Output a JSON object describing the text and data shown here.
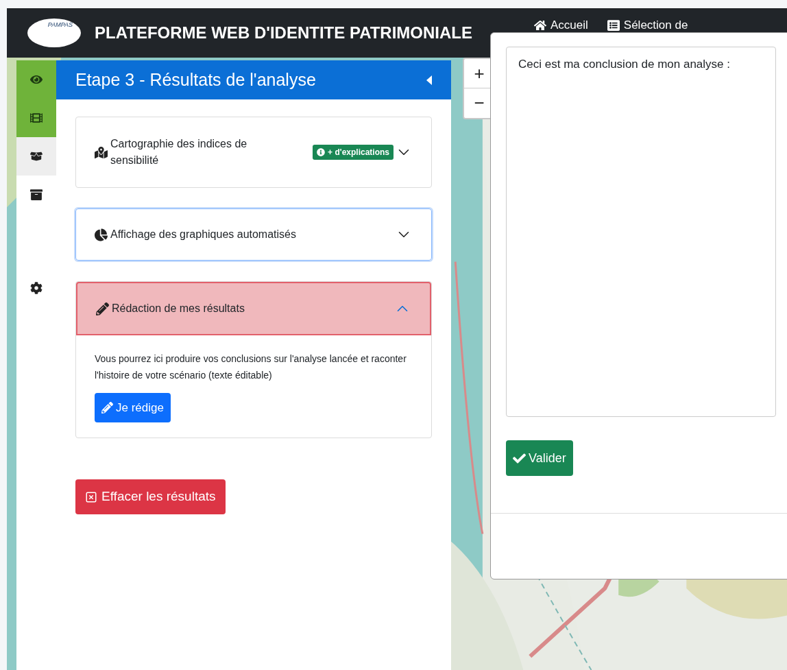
{
  "header": {
    "logo_text": "PAMPAS",
    "title": "PLATEFORME WEB D'IDENTITE PATRIMONIALE",
    "nav": [
      {
        "label": "Accueil",
        "kind": "home"
      },
      {
        "label": "Sélection de",
        "kind": "list"
      }
    ]
  },
  "sidebar": {
    "items": [
      {
        "kind": "eye",
        "highlighted": true,
        "selected": false
      },
      {
        "kind": "film",
        "highlighted": true,
        "selected": false
      },
      {
        "kind": "box",
        "highlighted": false,
        "selected": true
      },
      {
        "kind": "archive",
        "highlighted": false,
        "selected": false
      },
      {
        "kind": "gear",
        "highlighted": false,
        "selected": false
      }
    ]
  },
  "panel": {
    "title": "Etape 3 - Résultats de l'analyse",
    "sections": [
      {
        "kind": "map",
        "title": "Cartographie des indices de sensibilité",
        "badge": "+ d'explications",
        "expanded": false,
        "focused": false
      },
      {
        "kind": "chart",
        "title": "Affichage des graphiques automatisés",
        "expanded": false,
        "focused": true
      },
      {
        "kind": "pencil",
        "title": "Rédaction de mes résultats",
        "expanded": true,
        "focused": false,
        "body": "Vous pourrez ici produire vos conclusions sur l'analyse lancée et raconter l'histoire de votre scénario (texte éditable)",
        "button": "Je rédige"
      }
    ],
    "clear_button": "Effacer les résultats"
  },
  "map": {
    "zoom_in": "+",
    "zoom_out": "−"
  },
  "modal": {
    "text": "Ceci est ma conclusion de mon analyse :",
    "submit": "Valider"
  }
}
